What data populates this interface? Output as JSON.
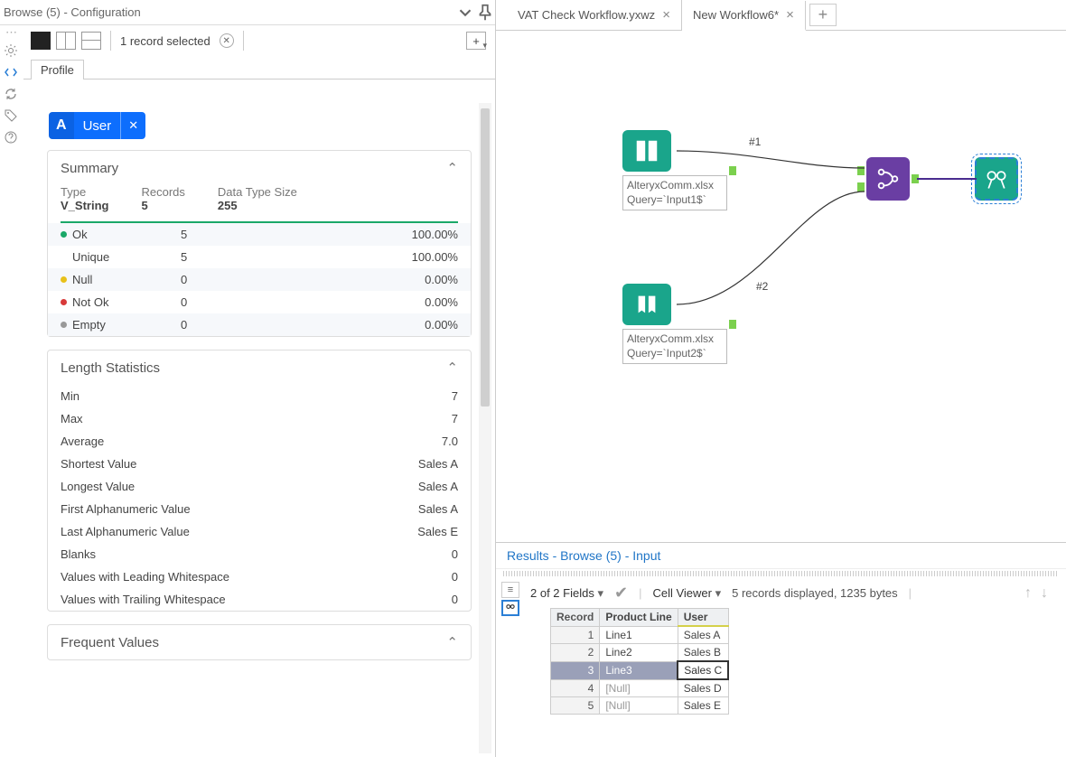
{
  "left_panel": {
    "title": "Browse (5) - Configuration",
    "records_selected": "1 record selected",
    "tab": "Profile",
    "field_chip": {
      "type_letter": "A",
      "name": "User"
    },
    "summary": {
      "header": "Summary",
      "type_label": "Type",
      "type_value": "V_String",
      "records_label": "Records",
      "records_value": "5",
      "size_label": "Data Type Size",
      "size_value": "255",
      "rows": [
        {
          "dot": "green",
          "name": "Ok",
          "count": "5",
          "pct": "100.00%"
        },
        {
          "dot": "",
          "name": "Unique",
          "count": "5",
          "pct": "100.00%"
        },
        {
          "dot": "yellow",
          "name": "Null",
          "count": "0",
          "pct": "0.00%"
        },
        {
          "dot": "red",
          "name": "Not Ok",
          "count": "0",
          "pct": "0.00%"
        },
        {
          "dot": "grey",
          "name": "Empty",
          "count": "0",
          "pct": "0.00%"
        }
      ]
    },
    "length_stats": {
      "header": "Length Statistics",
      "rows": [
        {
          "k": "Min",
          "v": "7"
        },
        {
          "k": "Max",
          "v": "7"
        },
        {
          "k": "Average",
          "v": "7.0"
        },
        {
          "k": "Shortest Value",
          "v": "Sales A"
        },
        {
          "k": "Longest Value",
          "v": "Sales A"
        },
        {
          "k": "First Alphanumeric Value",
          "v": "Sales A"
        },
        {
          "k": "Last Alphanumeric Value",
          "v": "Sales E"
        },
        {
          "k": "Blanks",
          "v": "0"
        },
        {
          "k": "Values with Leading Whitespace",
          "v": "0"
        },
        {
          "k": "Values with Trailing Whitespace",
          "v": "0"
        }
      ]
    },
    "frequent_values": {
      "header": "Frequent Values"
    }
  },
  "canvas_tabs": [
    {
      "label": "VAT Check Workflow.yxwz",
      "active": false
    },
    {
      "label": "New Workflow6*",
      "active": true
    }
  ],
  "canvas": {
    "input1_label": "AlteryxComm.xlsx\nQuery=`Input1$`",
    "input2_label": "AlteryxComm.xlsx\nQuery=`Input2$`",
    "conn1": "#1",
    "conn2": "#2"
  },
  "results": {
    "title": "Results - Browse (5) - Input",
    "fields_dd": "2 of 2 Fields",
    "cell_viewer": "Cell Viewer",
    "rec_info": "5 records displayed, 1235 bytes",
    "columns": [
      "Record",
      "Product Line",
      "User"
    ],
    "rows": [
      {
        "n": "1",
        "pl": "Line1",
        "u": "Sales A"
      },
      {
        "n": "2",
        "pl": "Line2",
        "u": "Sales B"
      },
      {
        "n": "3",
        "pl": "Line3",
        "u": "Sales C",
        "selected": true
      },
      {
        "n": "4",
        "pl": "[Null]",
        "u": "Sales D",
        "null": true
      },
      {
        "n": "5",
        "pl": "[Null]",
        "u": "Sales E",
        "null": true
      }
    ]
  }
}
